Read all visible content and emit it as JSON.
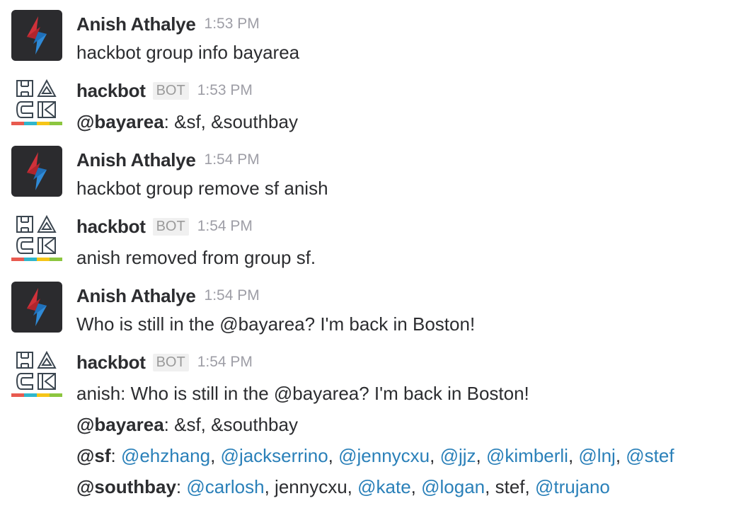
{
  "messages": [
    {
      "author": "Anish Athalye",
      "avatar_icon": "lightning-bolt-avatar-icon",
      "time": "1:53 PM",
      "lines": [
        "hackbot group info bayarea"
      ]
    },
    {
      "author": "hackbot",
      "avatar_icon": "hack-logo-avatar-icon",
      "badge": "BOT",
      "time": "1:53 PM",
      "reply": {
        "tag": "@bayarea",
        "text": ": &sf, &southbay"
      }
    },
    {
      "author": "Anish Athalye",
      "avatar_icon": "lightning-bolt-avatar-icon",
      "time": "1:54 PM",
      "lines": [
        "hackbot group remove sf anish"
      ]
    },
    {
      "author": "hackbot",
      "avatar_icon": "hack-logo-avatar-icon",
      "badge": "BOT",
      "time": "1:54 PM",
      "lines": [
        "anish removed from group sf."
      ]
    },
    {
      "author": "Anish Athalye",
      "avatar_icon": "lightning-bolt-avatar-icon",
      "time": "1:54 PM",
      "lines": [
        "Who is still in the @bayarea? I'm back in Boston!"
      ]
    },
    {
      "author": "hackbot",
      "avatar_icon": "hack-logo-avatar-icon",
      "badge": "BOT",
      "time": "1:54 PM",
      "first_line": "anish: Who is still in the @bayarea? I'm back in Boston!",
      "bayarea": {
        "tag": "@bayarea",
        "text": ": &sf, &southbay"
      },
      "sf": {
        "tag": "@sf",
        "sep": ": ",
        "comma": ", ",
        "members": [
          "@ehzhang",
          "@jackserrino",
          "@jennycxu",
          "@jjz",
          "@kimberli",
          "@lnj",
          "@stef"
        ]
      },
      "southbay": {
        "tag": "@southbay",
        "sep": ": ",
        "comma": ", ",
        "members": [
          {
            "text": "@carlosh",
            "link": true
          },
          {
            "text": "jennycxu",
            "link": false
          },
          {
            "text": "@kate",
            "link": true
          },
          {
            "text": "@logan",
            "link": true
          },
          {
            "text": "stef",
            "link": false
          },
          {
            "text": "@trujano",
            "link": true
          }
        ]
      }
    }
  ],
  "colors": {
    "mention_link": "#2a80b9",
    "user_avatar_bg": "#2b2b2e",
    "bolt_red": "#d0313a",
    "bolt_blue": "#2f8ad6",
    "hack_stripe": [
      "#e85a4f",
      "#30b6cc",
      "#f5c518",
      "#8cc63f"
    ]
  }
}
